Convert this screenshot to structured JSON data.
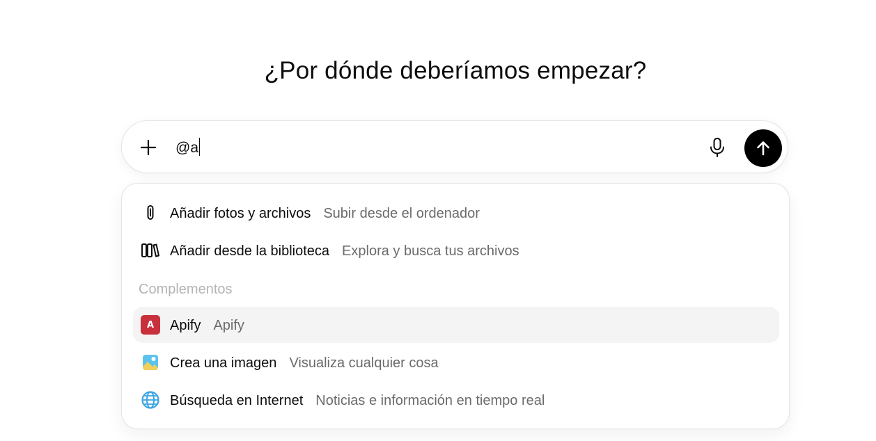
{
  "heading": "¿Por dónde deberíamos empezar?",
  "composer": {
    "input_value": "@a",
    "plus_icon": "plus-icon",
    "mic_icon": "microphone-icon",
    "send_icon": "arrow-up-icon"
  },
  "menu": {
    "items_top": [
      {
        "icon": "paperclip-icon",
        "title": "Añadir fotos y archivos",
        "description": "Subir desde el ordenador"
      },
      {
        "icon": "library-icon",
        "title": "Añadir desde la biblioteca",
        "description": "Explora y busca tus archivos"
      }
    ],
    "section_label": "Complementos",
    "plugins": [
      {
        "icon": "apify-logo",
        "badge": "A",
        "title": "Apify",
        "description": "Apify",
        "highlighted": true
      },
      {
        "icon": "image-icon",
        "title": "Crea una imagen",
        "description": "Visualiza cualquier cosa",
        "highlighted": false
      },
      {
        "icon": "globe-icon",
        "title": "Búsqueda en Internet",
        "description": "Noticias e información en tiempo real",
        "highlighted": false
      }
    ]
  },
  "colors": {
    "send_button": "#000000",
    "highlight_row": "#f4f4f4",
    "apify_brand": "#c8303c",
    "globe_blue": "#3aa3e3",
    "secondary_text": "#6b6b6b",
    "section_label": "#b4b4b4"
  }
}
